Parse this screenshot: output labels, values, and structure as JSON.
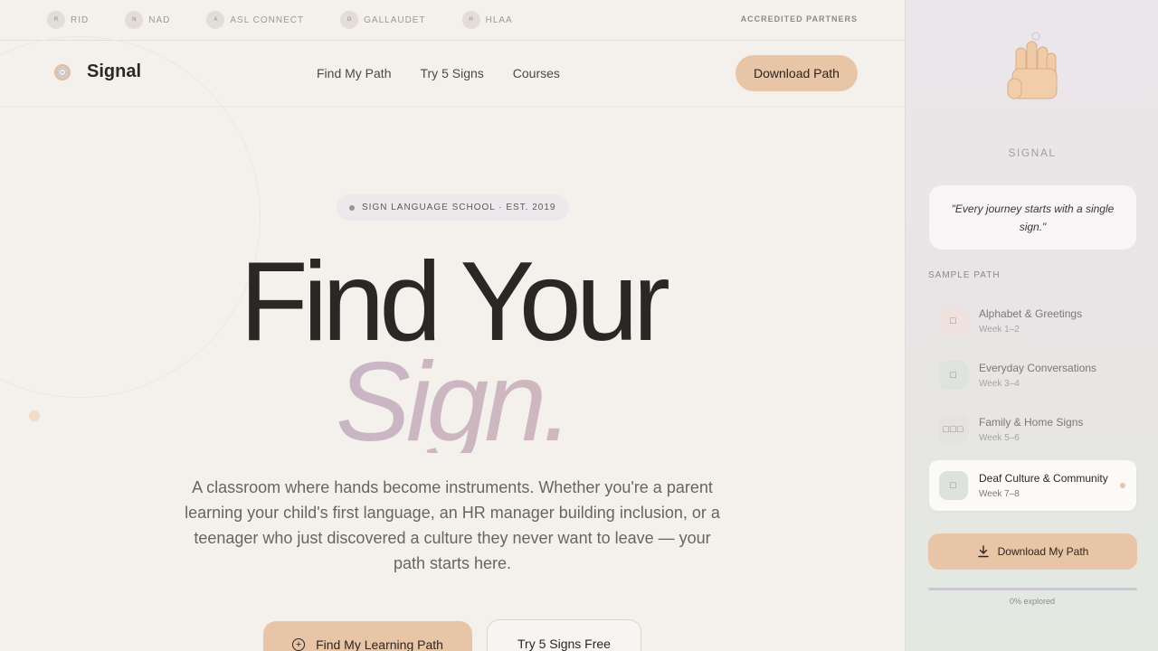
{
  "partners": {
    "items": [
      {
        "badge": "R",
        "name": "RID"
      },
      {
        "badge": "N",
        "name": "NAD"
      },
      {
        "badge": "A",
        "name": "ASL CONNECT"
      },
      {
        "badge": "G",
        "name": "GALLAUDET"
      },
      {
        "badge": "H",
        "name": "HLAA"
      }
    ],
    "label": "ACCREDITED PARTNERS"
  },
  "nav": {
    "brand": "Signal",
    "links": [
      "Find My Path",
      "Try 5 Signs",
      "Courses"
    ],
    "cta": "Download Path"
  },
  "hero": {
    "pill": "SIGN LANGUAGE SCHOOL · EST. 2019",
    "line1": "Find Your",
    "line2": "Sign.",
    "description": "A classroom where hands become instruments. Whether you're a parent learning your child's first language, an HR manager building inclusion, or a teenager who just discovered a culture they never want to leave — your path starts here.",
    "primary_button": "Find My Learning Path",
    "secondary_button": "Try 5 Signs Free"
  },
  "panel": {
    "brand": "SIGNAL",
    "quote": "\"Every journey starts with a single sign.\"",
    "path_label": "SAMPLE PATH",
    "path": [
      {
        "title": "Alphabet & Greetings",
        "week": "Week 1–2",
        "icon": "□",
        "icon_bg": "#efe1dd",
        "active": false
      },
      {
        "title": "Everyday Conversations",
        "week": "Week 3–4",
        "icon": "□",
        "icon_bg": "#dfe3dd",
        "active": false
      },
      {
        "title": "Family & Home Signs",
        "week": "Week 5–6",
        "icon": "□□□",
        "icon_bg": "#e4e3e1",
        "active": false
      },
      {
        "title": "Deaf Culture & Community",
        "week": "Week 7–8",
        "icon": "□",
        "icon_bg": "#dde3dc",
        "active": true
      }
    ],
    "download_button": "Download My Path",
    "progress_fraction": 0,
    "progress_label": "0% explored"
  },
  "colors": {
    "accent": "#e9c5a7",
    "background": "#f4f1ed",
    "text": "#2b2724"
  }
}
